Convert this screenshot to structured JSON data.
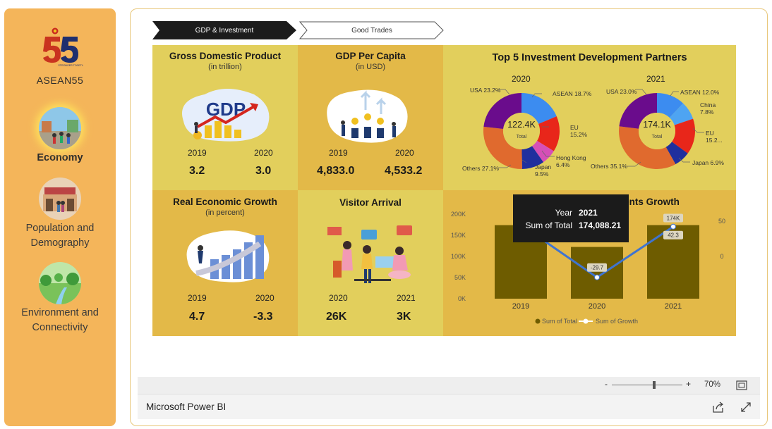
{
  "sidebar": {
    "brand": "ASEAN55",
    "logo_text": "STRONGER TOGETHER",
    "items": [
      {
        "label": "Economy",
        "active": true
      },
      {
        "label": "Population and Demography",
        "active": false
      },
      {
        "label": "Environment and Connectivity",
        "active": false
      }
    ]
  },
  "tabs": [
    {
      "label": "GDP & Investment",
      "active": true
    },
    {
      "label": "Good Trades",
      "active": false
    }
  ],
  "gdp": {
    "title": "Gross Domestic Product",
    "subtitle": "(in trillion)",
    "icon_text": "GDP",
    "y1": "2019",
    "y2": "2020",
    "v1": "3.2",
    "v2": "3.0"
  },
  "gdp_per_capita": {
    "title": "GDP Per Capita",
    "subtitle": "(in USD)",
    "y1": "2019",
    "y2": "2020",
    "v1": "4,833.0",
    "v2": "4,533.2"
  },
  "real_growth": {
    "title": "Real Economic Growth",
    "subtitle": "(in percent)",
    "y1": "2019",
    "y2": "2020",
    "v1": "4.7",
    "v2": "-3.3"
  },
  "visitor": {
    "title": "Visitor Arrival",
    "y1": "2020",
    "y2": "2021",
    "v1": "26K",
    "v2": "3K"
  },
  "partners": {
    "title": "Top 5 Investment Development Partners",
    "center_sub": "Total",
    "pie_2020": {
      "year": "2020",
      "total": "122.4K",
      "slices": [
        {
          "name": "ASEAN",
          "pct": 18.7,
          "label": "ASEAN 18.7%",
          "color": "#3c8cf0"
        },
        {
          "name": "EU",
          "pct": 15.2,
          "label": "EU 15.2%",
          "color": "#e8261a"
        },
        {
          "name": "Hong Kong",
          "pct": 6.4,
          "label": "Hong Kong 6.4%",
          "color": "#d64fb7"
        },
        {
          "name": "Japan",
          "pct": 9.5,
          "label": "Japan 9.5%",
          "color": "#1f2f9e"
        },
        {
          "name": "Others",
          "pct": 27.1,
          "label": "Others 27.1%",
          "color": "#e06a2e"
        },
        {
          "name": "USA",
          "pct": 23.2,
          "label": "USA 23.2%",
          "color": "#6a0c8c"
        }
      ]
    },
    "pie_2021": {
      "year": "2021",
      "total": "174.1K",
      "slices": [
        {
          "name": "ASEAN",
          "pct": 12.0,
          "label": "ASEAN 12.0%",
          "color": "#3c8cf0"
        },
        {
          "name": "China",
          "pct": 7.8,
          "label": "China 7.8%",
          "color": "#4ea4f2"
        },
        {
          "name": "EU",
          "pct": 15.2,
          "label": "EU 15.2...",
          "color": "#e8261a"
        },
        {
          "name": "Japan",
          "pct": 6.9,
          "label": "Japan 6.9%",
          "color": "#1f2f9e"
        },
        {
          "name": "Others",
          "pct": 35.1,
          "label": "Others 35.1%",
          "color": "#e06a2e"
        },
        {
          "name": "USA",
          "pct": 23.0,
          "label": "USA 23.0%",
          "color": "#6a0c8c"
        }
      ]
    }
  },
  "investment_growth": {
    "title": "Investments Growth",
    "legend_total": "Sum of Total",
    "legend_growth": "Sum of Growth",
    "left_ticks": [
      "200K",
      "150K",
      "100K",
      "50K",
      "0K"
    ],
    "right_ticks": [
      "50",
      "0"
    ],
    "chart_data": {
      "type": "bar",
      "categories": [
        "2019",
        "2020",
        "2021"
      ],
      "series": [
        {
          "name": "Sum of Total",
          "type": "bar",
          "values": [
            174000,
            122400,
            174088.21
          ],
          "data_labels": [
            "",
            "",
            "174K"
          ]
        },
        {
          "name": "Sum of Growth",
          "type": "line",
          "values": [
            45,
            -29.7,
            42.3
          ],
          "data_labels": [
            "",
            "-29.7",
            "42.3"
          ]
        }
      ],
      "ylim": [
        0,
        200000
      ],
      "y2lim": [
        -60,
        60
      ]
    },
    "tooltip": {
      "k1": "Year",
      "v1": "2021",
      "k2": "Sum of Total",
      "v2": "174,088.21"
    }
  },
  "colors": {
    "sidebar": "#f4b55a",
    "tile_light": "#e2cf5c",
    "tile_dark": "#e3b948",
    "bar": "#6e5c00",
    "line": "#3f74d0",
    "tab_active": "#1c1c1c"
  },
  "toolbar": {
    "zoom_minus": "-",
    "zoom_plus": "+",
    "zoom": "70%",
    "zoom_fraction": 0.6
  },
  "footer": {
    "brand": "Microsoft Power BI"
  }
}
